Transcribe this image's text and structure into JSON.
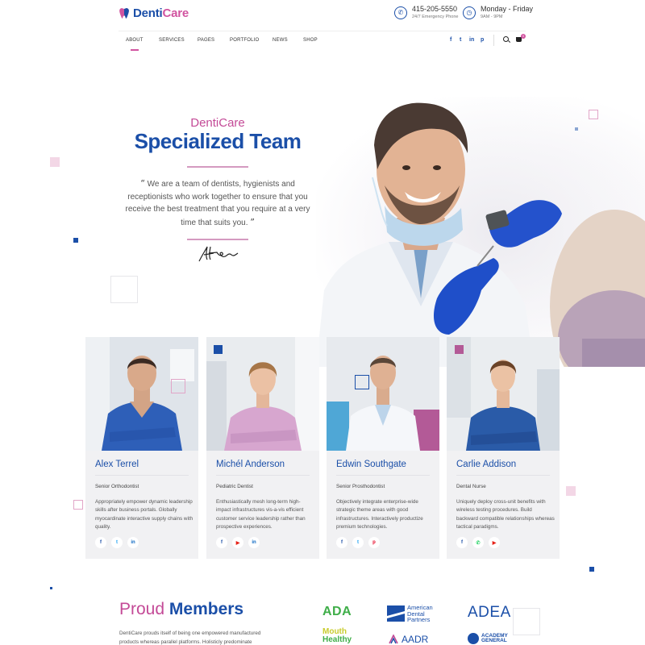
{
  "brand": {
    "part1": "Denti",
    "part2": "Care"
  },
  "contacts": {
    "phone": {
      "main": "415-205-5550",
      "sub": "24/7 Emergency Phone"
    },
    "hours": {
      "main": "Monday - Friday",
      "sub": "9AM - 9PM"
    }
  },
  "nav": {
    "items": [
      "ABOUT",
      "SERVICES",
      "PAGES",
      "PORTFOLIO",
      "NEWS",
      "SHOP"
    ],
    "social": [
      "f",
      "t",
      "in",
      "p"
    ],
    "cart_count": "0"
  },
  "hero": {
    "brand": "DentiCare",
    "title": "Specialized Team",
    "quote_open": "“",
    "quote": "We are a team of dentists, hygienists and receptionists who work together to ensure that you receive the best treatment that you require at a very time that suits you.",
    "quote_close": "”"
  },
  "team": [
    {
      "name": "Alex Terrel",
      "role": "Senior Orthodontist",
      "desc": "Appropriately empower dynamic leadership skills after business portals. Globally myocardinate interactive supply chains with quality.",
      "social": [
        "f",
        "t",
        "in"
      ]
    },
    {
      "name": "Michél Anderson",
      "role": "Pediatric Dentist",
      "desc": "Enthusiastically mesh long-term high-impact infrastructures vis-a-vis efficient customer service leadership rather than prospective experiences.",
      "social": [
        "f",
        "▶",
        "in"
      ]
    },
    {
      "name": "Edwin Southgate",
      "role": "Senior Prosthodontist",
      "desc": "Objectively integrate enterprise-wide strategic theme areas with good infrastructures. Interactively productize premium technologies.",
      "social": [
        "f",
        "t",
        "p"
      ]
    },
    {
      "name": "Carlie Addison",
      "role": "Dental Nurse",
      "desc": "Uniquely deploy cross-unit benefits with wireless testing procedures. Build backward compatible relationships whereas tactical paradigms.",
      "social": [
        "f",
        "✆",
        "▶"
      ]
    }
  ],
  "members": {
    "title_part1": "Proud",
    "title_part2": "Members",
    "text": "DentiCare prouds itself of being one empowered manufactured products whereas parallel platforms. Holisticly predominate",
    "logos": {
      "ada": "ADA",
      "adp": [
        "American",
        "Dental",
        "Partners"
      ],
      "adea": "ADEA",
      "mh1": "Mouth",
      "mh2": "Healthy",
      "aadr": "AADR",
      "academy": [
        "ACADEMY",
        "GENERAL"
      ]
    }
  },
  "colors": {
    "primary": "#1b4fa8",
    "accent": "#c44a97",
    "card_bg": "#f1f1f3"
  }
}
